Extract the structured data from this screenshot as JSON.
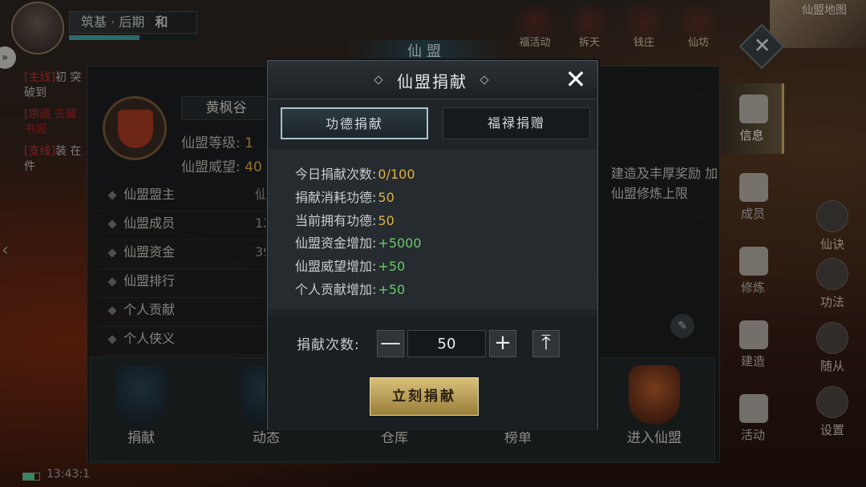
{
  "hud": {
    "realm": "筑基 · 后期",
    "realm_tag": "和",
    "realm_progress": 0.55,
    "map_label": "仙盟地图",
    "top_icons": [
      "福活动",
      "拆天",
      "钱庄",
      "仙坊"
    ],
    "clock": "13:43:1"
  },
  "chat": [
    {
      "tag": "[主线]",
      "text": "初 突破到"
    },
    {
      "tag": "[宗",
      "text": "藏 去藏书阁"
    },
    {
      "tag": "[支线]",
      "text": "装 在 件"
    }
  ],
  "guild_panel": {
    "title": "仙盟",
    "guild_name": "黄枫谷",
    "level_label": "仙盟等级:",
    "level_value": "1",
    "prestige_label": "仙盟威望:",
    "prestige_value": "40",
    "rows": [
      {
        "label": "仙盟盟主",
        "value": "仙"
      },
      {
        "label": "仙盟成员",
        "value": "12"
      },
      {
        "label": "仙盟资金",
        "value": "39"
      },
      {
        "label": "仙盟排行",
        "value": ""
      },
      {
        "label": "个人贡献",
        "value": ""
      },
      {
        "label": "个人侠义",
        "value": ""
      }
    ],
    "notice": "建造及丰厚奖励 加仙盟修炼上限",
    "bottom_actions": [
      "捐献",
      "动态",
      "仓库",
      "榜单",
      "进入仙盟"
    ]
  },
  "sidebar": {
    "tabs": [
      "信息",
      "成员",
      "修炼",
      "建造",
      "活动"
    ],
    "active": "信息",
    "outer": [
      "仙诀",
      "功法",
      "随从",
      "设置"
    ]
  },
  "modal": {
    "title": "仙盟捐献",
    "tabs": [
      "功德捐献",
      "福禄捐赠"
    ],
    "rows": [
      {
        "label": "今日捐献次数:",
        "value": "0/100",
        "color": "yellow"
      },
      {
        "label": "捐献消耗功德:",
        "value": "50",
        "color": "yellow"
      },
      {
        "label": "当前拥有功德:",
        "value": "50",
        "color": "yellow"
      },
      {
        "label": "仙盟资金增加:",
        "value": "+5000",
        "color": "green"
      },
      {
        "label": "仙盟威望增加:",
        "value": "+50",
        "color": "green"
      },
      {
        "label": "个人贡献增加:",
        "value": "+50",
        "color": "green"
      }
    ],
    "count_label": "捐献次数:",
    "count_value": "50",
    "minus": "—",
    "plus": "+",
    "max_symbol": "⤒",
    "confirm": "立刻捐献",
    "close": "✕"
  },
  "colors": {
    "yellow": "#e0b040",
    "green": "#6cc86c",
    "gold_button": "#c8ac64"
  }
}
